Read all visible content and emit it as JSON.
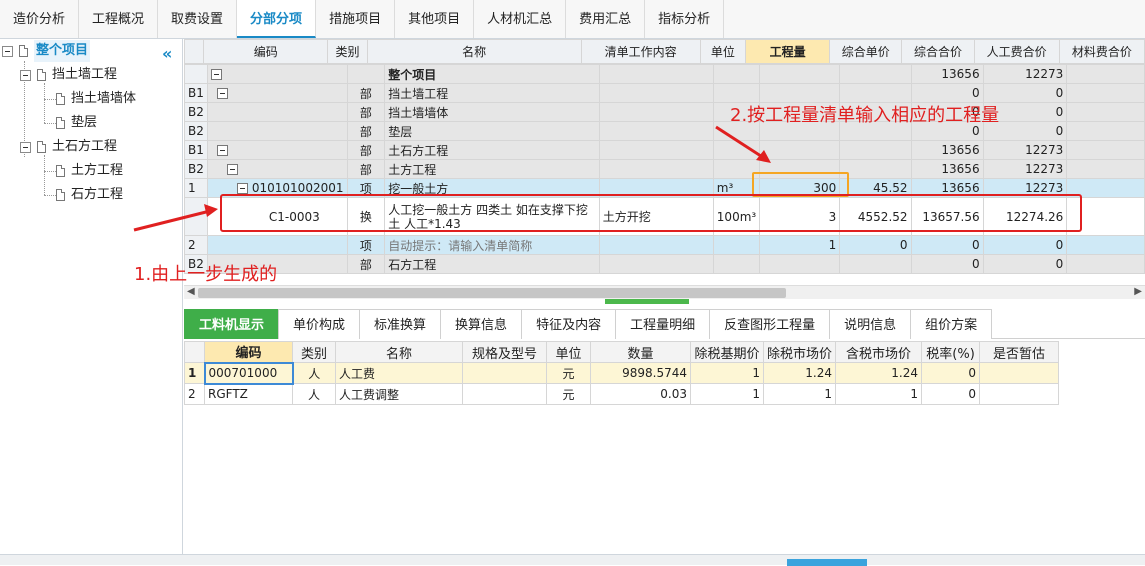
{
  "top_tabs": [
    "造价分析",
    "工程概况",
    "取费设置",
    "分部分项",
    "措施项目",
    "其他项目",
    "人材机汇总",
    "费用汇总",
    "指标分析"
  ],
  "active_top_tab": "分部分项",
  "tree": {
    "root": "整个项目",
    "items": [
      {
        "label": "挡土墙工程",
        "children": [
          "挡土墙墙体",
          "垫层"
        ]
      },
      {
        "label": "土石方工程",
        "children": [
          "土方工程",
          "石方工程"
        ]
      }
    ]
  },
  "main_grid": {
    "headers": [
      "编码",
      "类别",
      "名称",
      "清单工作内容",
      "单位",
      "工程量",
      "综合单价",
      "综合合价",
      "人工费合价",
      "材料费合价"
    ],
    "rows": [
      {
        "no": "",
        "code": "",
        "cat": "",
        "name": "整个项目",
        "content": "",
        "unit": "",
        "qty": "",
        "price": "",
        "total": "13656",
        "labor": "12273"
      },
      {
        "no": "B1",
        "code": "",
        "cat": "部",
        "name": "挡土墙工程",
        "content": "",
        "unit": "",
        "qty": "",
        "price": "",
        "total": "0",
        "labor": "0"
      },
      {
        "no": "B2",
        "code": "",
        "cat": "部",
        "name": "挡土墙墙体",
        "content": "",
        "unit": "",
        "qty": "",
        "price": "",
        "total": "0",
        "labor": "0"
      },
      {
        "no": "B2",
        "code": "",
        "cat": "部",
        "name": "垫层",
        "content": "",
        "unit": "",
        "qty": "",
        "price": "",
        "total": "0",
        "labor": "0"
      },
      {
        "no": "B1",
        "code": "",
        "cat": "部",
        "name": "土石方工程",
        "content": "",
        "unit": "",
        "qty": "",
        "price": "",
        "total": "13656",
        "labor": "12273"
      },
      {
        "no": "B2",
        "code": "",
        "cat": "部",
        "name": "土方工程",
        "content": "",
        "unit": "",
        "qty": "",
        "price": "",
        "total": "13656",
        "labor": "12273"
      },
      {
        "no": "1",
        "code": "010101002001",
        "cat": "项",
        "name": "挖一般土方",
        "content": "",
        "unit": "m³",
        "qty": "300",
        "price": "45.52",
        "total": "13656",
        "labor": "12273"
      },
      {
        "no": "",
        "code": "C1-0003",
        "cat": "换",
        "name": "人工挖一般土方 四类土  如在支撑下挖土 人工*1.43",
        "content": "土方开挖",
        "unit": "100m³",
        "qty": "3",
        "price": "4552.52",
        "total": "13657.56",
        "labor": "12274.26"
      },
      {
        "no": "2",
        "code": "",
        "cat": "项",
        "name": "自动提示：请输入清单简称",
        "content": "",
        "unit": "",
        "qty": "1",
        "price": "0",
        "total": "0",
        "labor": "0"
      },
      {
        "no": "B2",
        "code": "",
        "cat": "部",
        "name": "石方工程",
        "content": "",
        "unit": "",
        "qty": "",
        "price": "",
        "total": "0",
        "labor": "0"
      }
    ]
  },
  "bottom_tabs": [
    "工料机显示",
    "单价构成",
    "标准换算",
    "换算信息",
    "特征及内容",
    "工程量明细",
    "反查图形工程量",
    "说明信息",
    "组价方案"
  ],
  "active_bottom_tab": "工料机显示",
  "sub_grid": {
    "headers": [
      "编码",
      "类别",
      "名称",
      "规格及型号",
      "单位",
      "数量",
      "除税基期价",
      "除税市场价",
      "含税市场价",
      "税率(%)",
      "是否暂估"
    ],
    "rows": [
      {
        "no": "1",
        "code": "000701000",
        "cat": "人",
        "name": "人工费",
        "spec": "",
        "unit": "元",
        "qty": "9898.5744",
        "base": "1",
        "market": "1.24",
        "taxed": "1.24",
        "rate": "0",
        "est": ""
      },
      {
        "no": "2",
        "code": "RGFTZ",
        "cat": "人",
        "name": "人工费调整",
        "spec": "",
        "unit": "元",
        "qty": "0.03",
        "base": "1",
        "market": "1",
        "taxed": "1",
        "rate": "0",
        "est": ""
      }
    ]
  },
  "annotations": {
    "note1": "1.由上一步生成的",
    "note2": "2.按工程量清单输入相应的工程量"
  },
  "colors": {
    "accent": "#1a8ac6",
    "green_tab": "#3fae49",
    "annotation_red": "#e02020",
    "highlight_orange": "#f5a623"
  }
}
